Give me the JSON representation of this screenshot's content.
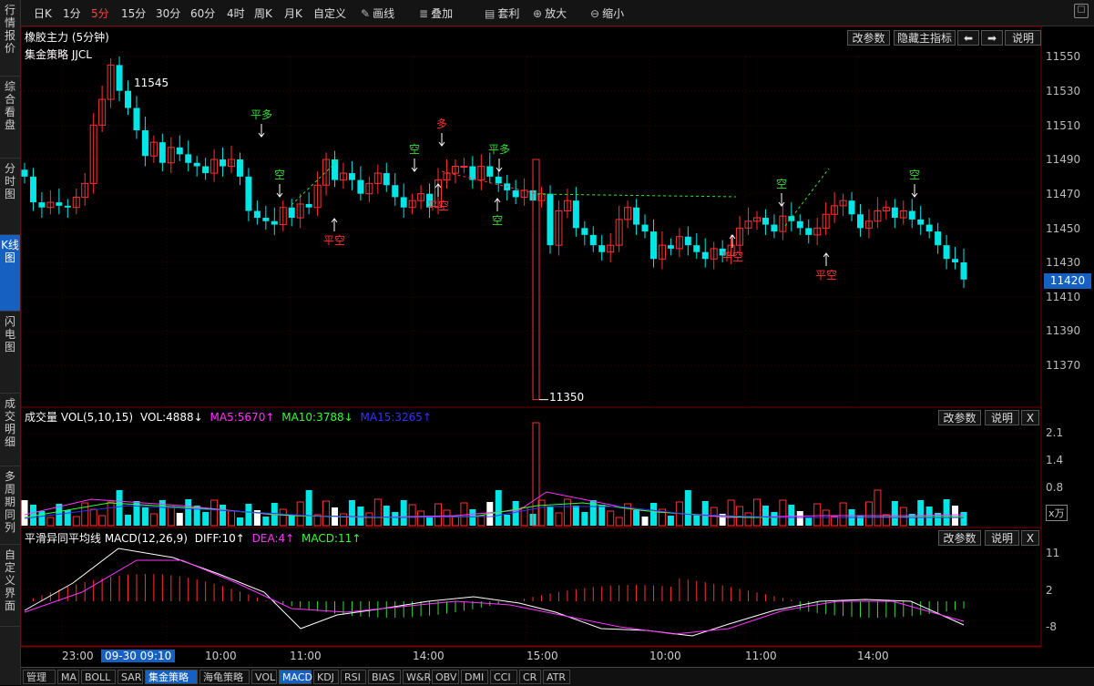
{
  "sidebar": [
    {
      "label": "行情报价"
    },
    {
      "label": "综合看盘"
    },
    {
      "label": "分时图"
    },
    {
      "label": "K线图"
    },
    {
      "label": "闪电图"
    },
    {
      "label": "成交明细"
    },
    {
      "label": "多周期同列"
    },
    {
      "label": "自定义界面"
    }
  ],
  "toolbar": {
    "periods": [
      "日K",
      "1分",
      "5分",
      "15分",
      "30分",
      "60分",
      "4时",
      "周K",
      "月K",
      "自定义"
    ],
    "active_period": "5分",
    "tools": [
      {
        "label": "画线",
        "icon": "pencil-icon"
      },
      {
        "label": "叠加",
        "icon": "stack-icon"
      },
      {
        "label": "套利",
        "icon": "arbitrage-icon"
      },
      {
        "label": "放大",
        "icon": "zoom-in-icon"
      },
      {
        "label": "缩小",
        "icon": "zoom-out-icon"
      }
    ]
  },
  "main": {
    "title": "橡胶主力 (5分钟)",
    "strategy": "集金策略 JJCL",
    "buttons": {
      "params": "改参数",
      "hide": "隐藏主指标",
      "left": "⬅",
      "right": "➡",
      "help": "说明"
    },
    "y_ticks": [
      "11550",
      "11530",
      "11510",
      "11490",
      "11470",
      "11450",
      "11430",
      "11410",
      "11390",
      "11370"
    ],
    "current_price": "11420",
    "high_label": "11545",
    "low_label": "11350"
  },
  "volume": {
    "title": "成交量 VOL(5,10,15)",
    "vol": "VOL:4888↓",
    "ma5": "MA5:5670↑",
    "ma10": "MA10:3788↓",
    "ma15": "MA15:3265↑",
    "y_ticks": [
      "2.1",
      "1.4",
      "0.8"
    ],
    "unit": "x万",
    "buttons": {
      "params": "改参数",
      "help": "说明",
      "close": "X"
    }
  },
  "macd": {
    "title": "平滑异同平均线 MACD(12,26,9)",
    "diff": "DIFF:10↑",
    "dea": "DEA:4↑",
    "macd": "MACD:11↑",
    "y_ticks": [
      "11",
      "2",
      "-8"
    ],
    "buttons": {
      "params": "改参数",
      "help": "说明",
      "close": "X"
    }
  },
  "xaxis": {
    "labels": [
      "23:00",
      "09-30 09:10",
      "10:00",
      "11:00",
      "14:00",
      "15:00",
      "10:00",
      "11:00",
      "14:00"
    ],
    "highlight": "09-30 09:10"
  },
  "bottom_tabs": [
    "管理",
    "MA",
    "BOLL",
    "SAR",
    "集金策略",
    "海龟策略",
    "VOL",
    "MACD",
    "KDJ",
    "RSI",
    "BIAS",
    "W&R",
    "OBV",
    "DMI",
    "CCI",
    "CR",
    "ATR"
  ],
  "bottom_active": [
    "集金策略",
    "MACD"
  ],
  "signals": [
    {
      "text": "平多",
      "color": "#33dd33"
    },
    {
      "text": "空",
      "color": "#33dd33"
    },
    {
      "text": "平空",
      "color": "#ff3333"
    },
    {
      "text": "空",
      "color": "#33dd33"
    },
    {
      "text": "多",
      "color": "#ff3333"
    },
    {
      "text": "平空",
      "color": "#ff3333"
    },
    {
      "text": "平多",
      "color": "#33dd33"
    },
    {
      "text": "空",
      "color": "#33dd33"
    },
    {
      "text": "平空",
      "color": "#ff3333"
    },
    {
      "text": "空",
      "color": "#33dd33"
    },
    {
      "text": "平空",
      "color": "#ff3333"
    },
    {
      "text": "空",
      "color": "#33dd33"
    }
  ],
  "colors": {
    "up": "#ff3030",
    "down": "#00e5e5",
    "grid": "#3a0000",
    "diff": "#ffffff",
    "dea": "#ff33ff",
    "ma5": "#ff33ff",
    "ma10": "#33ff33",
    "ma15": "#3333ff"
  }
}
